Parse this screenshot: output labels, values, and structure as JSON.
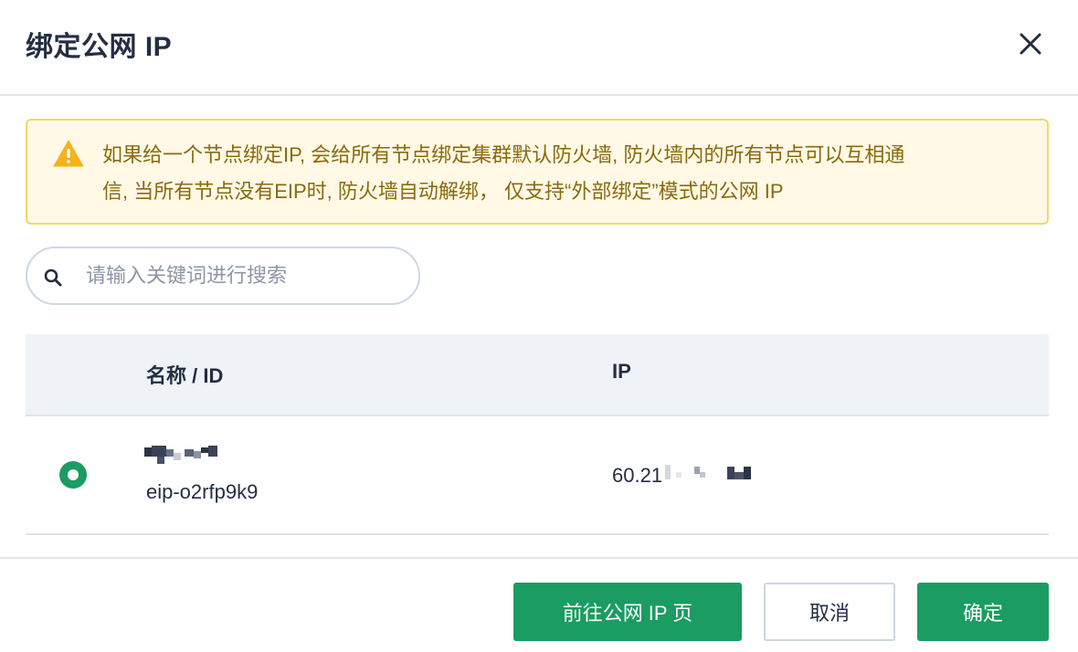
{
  "dialog": {
    "title": "绑定公网 IP"
  },
  "alert": {
    "line1": "如果给一个节点绑定IP, 会给所有节点绑定集群默认防火墙, 防火墙内的所有节点可以互相通",
    "line2": "信, 当所有节点没有EIP时, 防火墙自动解绑， 仅支持“外部绑定”模式的公网 IP"
  },
  "search": {
    "placeholder": "请输入关键词进行搜索"
  },
  "table": {
    "columns": [
      "名称 / ID",
      "IP"
    ],
    "rows": [
      {
        "selected": true,
        "id": "eip-o2rfp9k9",
        "ip_visible": "60.21"
      }
    ]
  },
  "footer": {
    "goto_label": "前往公网 IP 页",
    "cancel_label": "取消",
    "confirm_label": "确定"
  },
  "colors": {
    "primary": "#1a9c62",
    "warning_bg": "#fff9e6",
    "warning_border": "#f5d56b",
    "warning_text": "#8a6a0c"
  },
  "icons": [
    "warning-icon",
    "close-icon",
    "search-icon",
    "radio-selected-icon"
  ]
}
